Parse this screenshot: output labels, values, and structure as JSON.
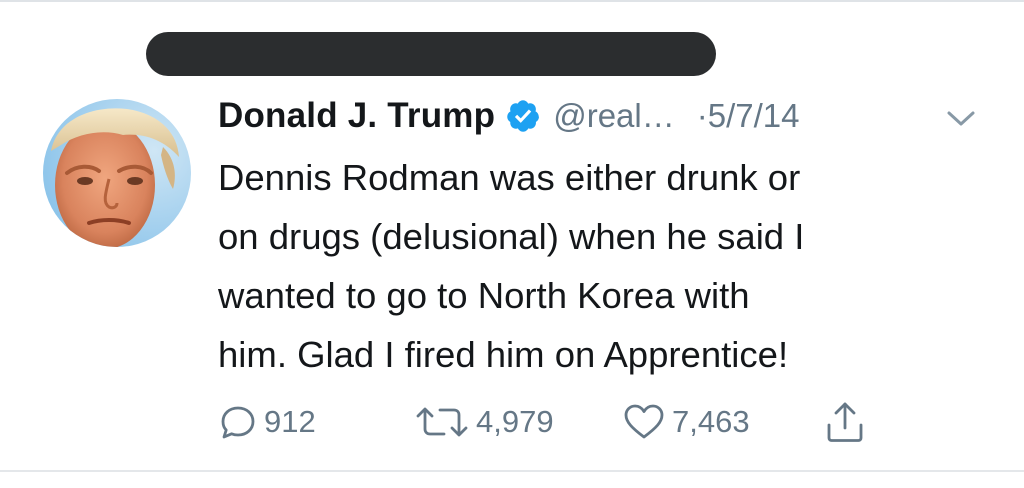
{
  "tweet": {
    "author": {
      "display_name": "Donald J. Trump",
      "handle": "@real…",
      "verified": true
    },
    "separator": "·",
    "date": "5/7/14",
    "text_lines": [
      "Dennis Rodman was either drunk or",
      "on drugs (delusional) when he said I",
      "wanted to go to North Korea with",
      "him. Glad I fired him on Apprentice!"
    ],
    "actions": {
      "reply_count": "912",
      "retweet_count": "4,979",
      "like_count": "7,463"
    }
  },
  "icons": {
    "verified": "verified-badge-icon",
    "caret": "chevron-down-icon",
    "reply": "reply-bubble-icon",
    "retweet": "retweet-arrows-icon",
    "like": "heart-icon",
    "share": "share-upload-icon"
  },
  "colors": {
    "text": "#14171a",
    "secondary": "#657786",
    "verified_blue": "#1da1f2",
    "redaction": "#2b2d2f",
    "divider": "#e4e7ea"
  }
}
